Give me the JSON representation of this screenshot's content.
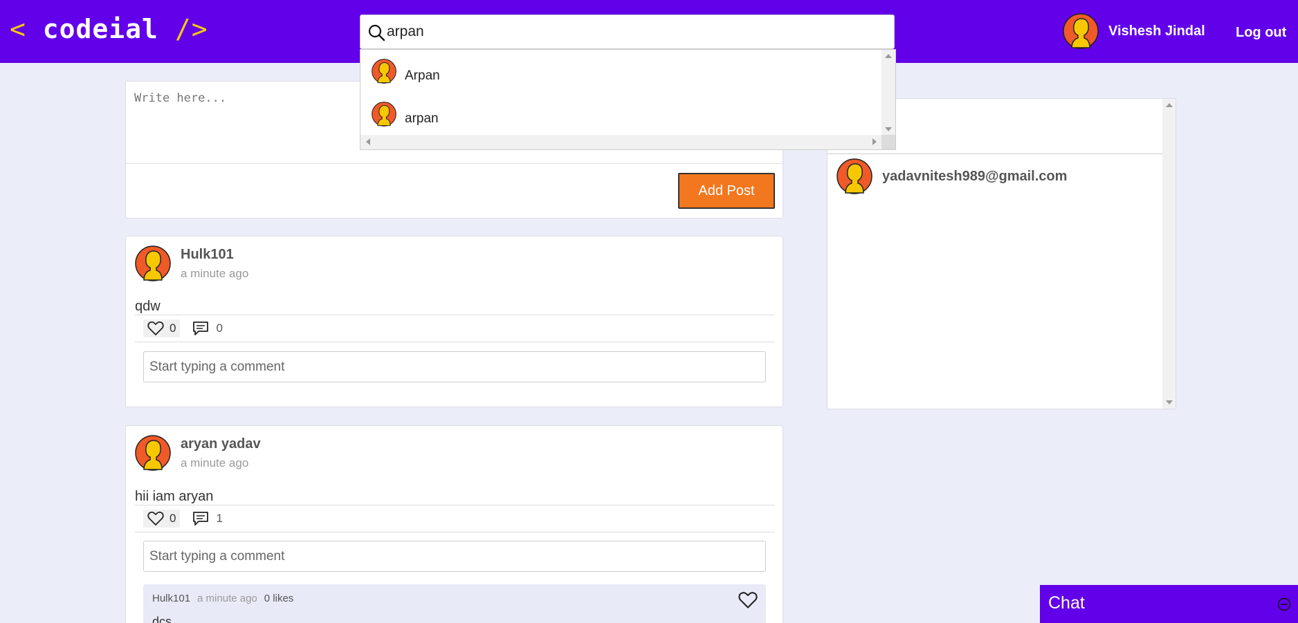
{
  "brand": {
    "open": "<",
    "name": "codeial",
    "close": "/>",
    "colors": {
      "primary": "#6200ea",
      "accent": "#f6c90e",
      "button": "#f3771f"
    }
  },
  "search": {
    "value": "arpan",
    "icon": "search-icon"
  },
  "search_results": [
    {
      "name": "Arpan"
    },
    {
      "name": "arpan"
    }
  ],
  "user": {
    "name": "Vishesh Jindal",
    "logout_label": "Log out"
  },
  "create_post": {
    "placeholder": "Write here...",
    "button_label": "Add Post"
  },
  "posts": [
    {
      "author": "Hulk101",
      "time": "a minute ago",
      "content": "qdw",
      "likes": "0",
      "comments_count": "0",
      "comment_placeholder": "Start typing a comment"
    },
    {
      "author": "aryan yadav",
      "time": "a minute ago",
      "content": "hii iam aryan",
      "likes": "0",
      "comments_count": "1",
      "comment_placeholder": "Start typing a comment",
      "comments": [
        {
          "author": "Hulk101",
          "time": "a minute ago",
          "likes": "0 likes",
          "text": "dcs"
        }
      ]
    }
  ],
  "friends": [
    {
      "email": "yadavnitesh989@gmail.com"
    }
  ],
  "chat": {
    "title": "Chat"
  }
}
